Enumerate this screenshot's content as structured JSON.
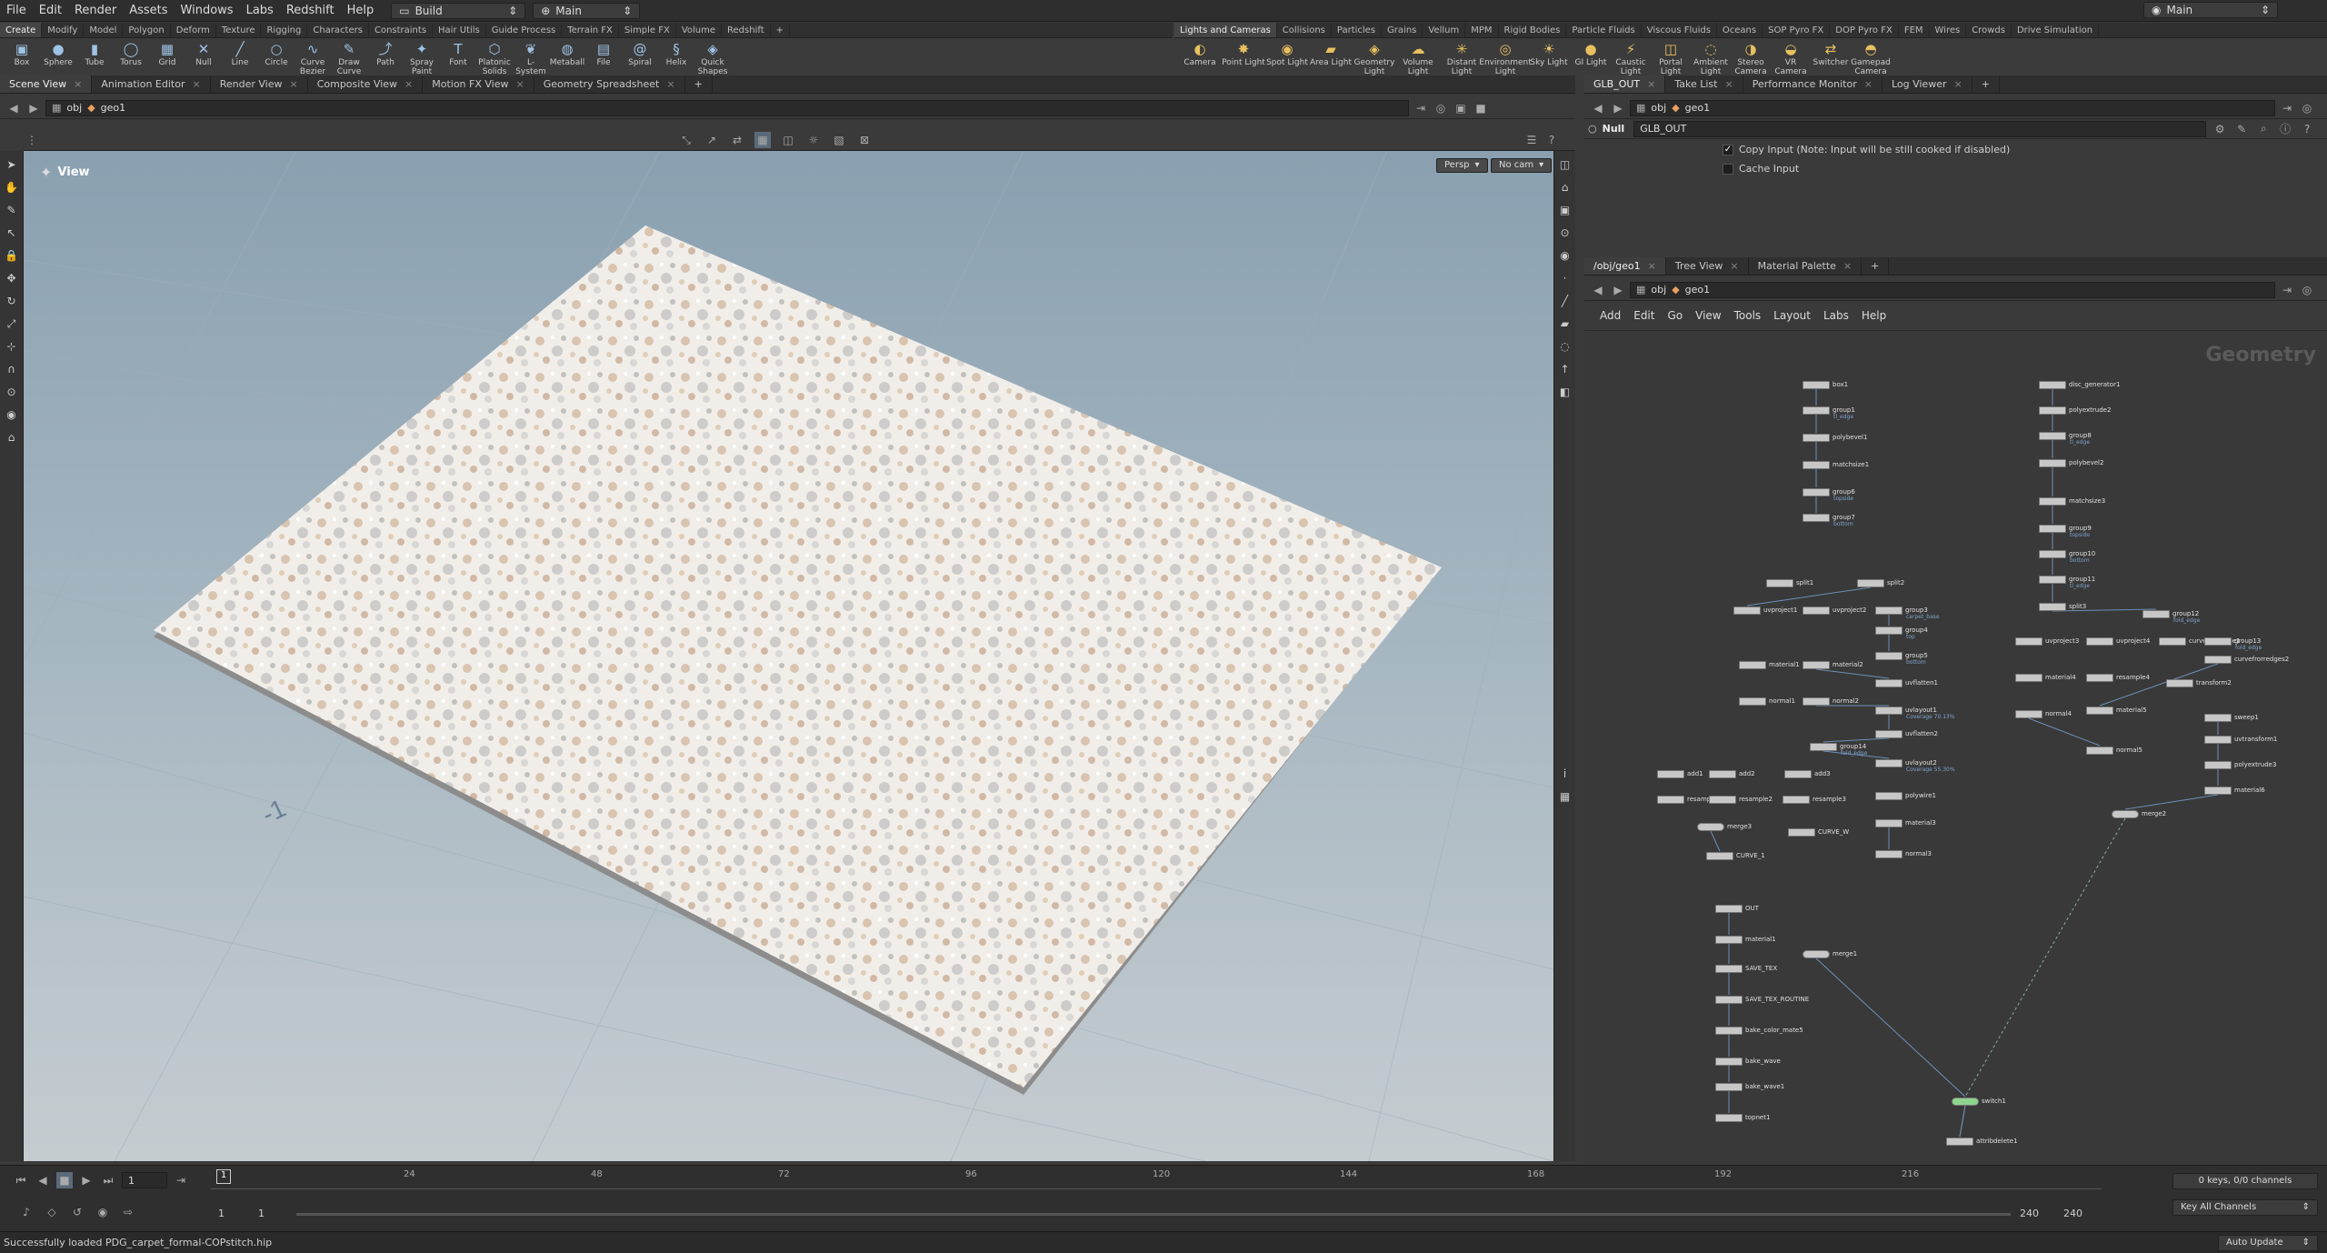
{
  "menubar": {
    "items": [
      "File",
      "Edit",
      "Render",
      "Assets",
      "Windows",
      "Labs",
      "Redshift",
      "Help"
    ],
    "desktop": "Build",
    "context": "Main",
    "right_context": "Main"
  },
  "shelf_left": {
    "tabs": [
      "Create",
      "Modify",
      "Model",
      "Polygon",
      "Deform",
      "Texture",
      "Rigging",
      "Characters",
      "Constraints",
      "Hair Utils",
      "Guide Process",
      "Terrain FX",
      "Simple FX",
      "Volume",
      "Redshift"
    ],
    "tools": [
      "Box",
      "Sphere",
      "Tube",
      "Torus",
      "Grid",
      "Null",
      "Line",
      "Circle",
      "Curve Bezier",
      "Draw Curve",
      "Path",
      "Spray Paint",
      "Font",
      "Platonic Solids",
      "L-System",
      "Metaball",
      "File",
      "Spiral",
      "Helix",
      "Quick Shapes"
    ]
  },
  "shelf_right": {
    "tabs": [
      "Lights and Cameras",
      "Collisions",
      "Particles",
      "Grains",
      "Vellum",
      "MPM",
      "Rigid Bodies",
      "Particle Fluids",
      "Viscous Fluids",
      "Oceans",
      "SOP Pyro FX",
      "DOP Pyro FX",
      "FEM",
      "Wires",
      "Crowds",
      "Drive Simulation"
    ],
    "tools": [
      "Camera",
      "Point Light",
      "Spot Light",
      "Area Light",
      "Geometry Light",
      "Volume Light",
      "Distant Light",
      "Environment Light",
      "Sky Light",
      "GI Light",
      "Caustic Light",
      "Portal Light",
      "Ambient Light",
      "Stereo Camera",
      "VR Camera",
      "Switcher",
      "Gamepad Camera"
    ]
  },
  "left_pane": {
    "tabs": [
      "Scene View",
      "Animation Editor",
      "Render View",
      "Composite View",
      "Motion FX View",
      "Geometry Spreadsheet"
    ],
    "path_root": "obj",
    "path_node": "geo1",
    "view_label": "View",
    "persp": "Persp",
    "cam": "No cam"
  },
  "param_pane": {
    "tabs": [
      "GLB_OUT",
      "Take List",
      "Performance Monitor",
      "Log Viewer"
    ],
    "path_root": "obj",
    "path_node": "geo1",
    "node_type": "Null",
    "node_name": "GLB_OUT",
    "copy_input_label": "Copy Input (Note: Input will be still cooked if disabled)",
    "cache_input_label": "Cache Input"
  },
  "network_pane": {
    "tabs": [
      "/obj/geo1",
      "Tree View",
      "Material Palette"
    ],
    "path_root": "obj",
    "path_node": "geo1",
    "menu": [
      "Add",
      "Edit",
      "Go",
      "View",
      "Tools",
      "Layout",
      "Labs",
      "Help"
    ],
    "watermark": "Geometry",
    "nodes": [
      {
        "n": "box1",
        "s": ""
      },
      {
        "n": "group1",
        "s": "tl_edge"
      },
      {
        "n": "polybevel1",
        "s": ""
      },
      {
        "n": "matchsize1",
        "s": ""
      },
      {
        "n": "group6",
        "s": "topside"
      },
      {
        "n": "group7",
        "s": "bottom"
      },
      {
        "n": "split1",
        "s": ""
      },
      {
        "n": "split2",
        "s": ""
      },
      {
        "n": "uvproject1",
        "s": ""
      },
      {
        "n": "uvproject2",
        "s": ""
      },
      {
        "n": "group3",
        "s": "carpet_base"
      },
      {
        "n": "group4",
        "s": "top"
      },
      {
        "n": "group5",
        "s": "bottom"
      },
      {
        "n": "material1",
        "s": ""
      },
      {
        "n": "material2",
        "s": ""
      },
      {
        "n": "uvflatten1",
        "s": ""
      },
      {
        "n": "normal1",
        "s": ""
      },
      {
        "n": "normal2",
        "s": ""
      },
      {
        "n": "uvlayout1",
        "s": "Coverage 70.13%"
      },
      {
        "n": "uvflatten2",
        "s": ""
      },
      {
        "n": "group14",
        "s": "fold_edge"
      },
      {
        "n": "uvlayout2",
        "s": "Coverage 55.30%"
      },
      {
        "n": "add1",
        "s": ""
      },
      {
        "n": "add2",
        "s": ""
      },
      {
        "n": "add3",
        "s": ""
      },
      {
        "n": "resample1",
        "s": ""
      },
      {
        "n": "resample2",
        "s": ""
      },
      {
        "n": "resample3",
        "s": ""
      },
      {
        "n": "polywire1",
        "s": ""
      },
      {
        "n": "merge3",
        "s": ""
      },
      {
        "n": "CURVE_1",
        "s": ""
      },
      {
        "n": "CURVE_W",
        "s": ""
      },
      {
        "n": "material3",
        "s": ""
      },
      {
        "n": "normal3",
        "s": ""
      },
      {
        "n": "OUT",
        "s": ""
      },
      {
        "n": "material1",
        "s": ""
      },
      {
        "n": "SAVE_TEX",
        "s": ""
      },
      {
        "n": "SAVE_TEX_ROUTINE",
        "s": ""
      },
      {
        "n": "bake_color_mate5",
        "s": ""
      },
      {
        "n": "bake_wave",
        "s": ""
      },
      {
        "n": "bake_wave1",
        "s": ""
      },
      {
        "n": "topnet1",
        "s": ""
      },
      {
        "n": "merge1",
        "s": ""
      },
      {
        "n": "switch1",
        "s": ""
      },
      {
        "n": "attribdelete1",
        "s": ""
      },
      {
        "n": "disc_generator1",
        "s": ""
      },
      {
        "n": "polyextrude2",
        "s": ""
      },
      {
        "n": "group8",
        "s": "tl_edge"
      },
      {
        "n": "polybevel2",
        "s": ""
      },
      {
        "n": "matchsize3",
        "s": ""
      },
      {
        "n": "group9",
        "s": "topside"
      },
      {
        "n": "group10",
        "s": "bottom"
      },
      {
        "n": "group11",
        "s": "tl_edge"
      },
      {
        "n": "split3",
        "s": ""
      },
      {
        "n": "group12",
        "s": "fold_edge"
      },
      {
        "n": "uvproject3",
        "s": ""
      },
      {
        "n": "uvproject4",
        "s": ""
      },
      {
        "n": "curvefrorredge1",
        "s": ""
      },
      {
        "n": "group13",
        "s": "fold_edge"
      },
      {
        "n": "material4",
        "s": ""
      },
      {
        "n": "resample4",
        "s": ""
      },
      {
        "n": "curvefrorredges2",
        "s": ""
      },
      {
        "n": "material5",
        "s": ""
      },
      {
        "n": "transform2",
        "s": ""
      },
      {
        "n": "normal4",
        "s": ""
      },
      {
        "n": "normal5",
        "s": ""
      },
      {
        "n": "sweep1",
        "s": ""
      },
      {
        "n": "uvtransform1",
        "s": ""
      },
      {
        "n": "polyextrude3",
        "s": ""
      },
      {
        "n": "material6",
        "s": ""
      },
      {
        "n": "merge2",
        "s": ""
      }
    ]
  },
  "timeline": {
    "current_frame": "1",
    "ticks": [
      "24",
      "48",
      "72",
      "96",
      "120",
      "144",
      "168",
      "192",
      "216"
    ],
    "start": "1",
    "start2": "1",
    "end": "240",
    "end2": "240",
    "keys_info": "0 keys, 0/0 channels",
    "key_all": "Key All Channels",
    "auto_update": "Auto Update"
  },
  "status": "Successfully loaded PDG_carpet_formal-COPstitch.hip"
}
